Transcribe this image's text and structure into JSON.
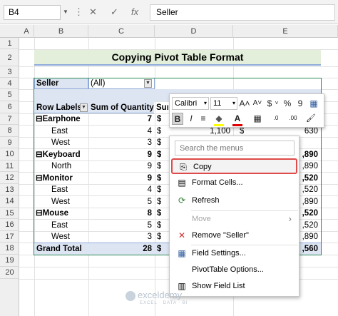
{
  "formula_bar": {
    "name_box": "B4",
    "more": "⋮",
    "cancel": "✕",
    "enter": "✓",
    "fx": "fx",
    "content": "Seller"
  },
  "columns": [
    "A",
    "B",
    "C",
    "D",
    "E"
  ],
  "rows": [
    "1",
    "2",
    "3",
    "4",
    "5",
    "6",
    "7",
    "8",
    "9",
    "10",
    "11",
    "12",
    "13",
    "14",
    "15",
    "16",
    "17",
    "18",
    "19",
    "20"
  ],
  "title": "Copying Pivot Table Format",
  "pivot": {
    "filter_label": "Seller",
    "filter_value": "(All)",
    "header_row_labels": "Row Labels",
    "header_sum_quantity": "Sum of Quantity",
    "header_sum_partial": "Sum",
    "groups": [
      {
        "name": "Earphone",
        "qty": "7",
        "currency": "$",
        "value": "",
        "children": [
          {
            "name": "East",
            "qty": "4",
            "currency": "$",
            "value": "1,100",
            "currency2": "$",
            "value2": "630"
          },
          {
            "name": "West",
            "qty": "3",
            "currency": "$",
            "value": "",
            "value2": ""
          }
        ]
      },
      {
        "name": "Keyboard",
        "qty": "9",
        "currency": "$",
        "value": "",
        "children": [
          {
            "name": "North",
            "qty": "9",
            "currency": "$",
            "value": ""
          }
        ]
      },
      {
        "name": "Monitor",
        "qty": "9",
        "currency": "$",
        "value": "",
        "children": [
          {
            "name": "East",
            "qty": "4",
            "currency": "$",
            "value": ""
          },
          {
            "name": "West",
            "qty": "5",
            "currency": "$",
            "value": ""
          }
        ]
      },
      {
        "name": "Mouse",
        "qty": "8",
        "currency": "$",
        "value": "",
        "children": [
          {
            "name": "East",
            "qty": "5",
            "currency": "$",
            "value": ""
          },
          {
            "name": "West",
            "qty": "3",
            "currency": "$",
            "value": ""
          }
        ]
      }
    ],
    "grand_total_label": "Grand Total",
    "grand_total_qty": "28",
    "grand_total_currency": "$",
    "right_column_values": [
      "630",
      ",890",
      ",890",
      ",520",
      ",520",
      ",890",
      ",520",
      ",520",
      ",890",
      ",560"
    ]
  },
  "mini_toolbar": {
    "font": "Calibri",
    "size": "11",
    "grow_font": "A˄",
    "shrink_font": "A˅",
    "currency": "$",
    "format_arrow": "˅",
    "percent": "%",
    "comma": "9",
    "bold": "B",
    "italic": "I",
    "align": "≡",
    "highlight": "◆",
    "font_color": "A",
    "borders": "▦",
    "dec_increase": ".0",
    "dec_decrease": ".00",
    "painter": "🖌"
  },
  "context_menu": {
    "search_placeholder": "Search the menus",
    "items": [
      {
        "label": "Copy",
        "icon": "⎘"
      },
      {
        "label": "Format Cells...",
        "icon": "▤"
      },
      {
        "label": "Refresh",
        "icon": "⟳"
      },
      {
        "label": "Move",
        "arrow": "›"
      },
      {
        "label": "Remove \"Seller\"",
        "icon": "✕"
      },
      {
        "label": "Field Settings...",
        "icon": "▦"
      },
      {
        "label": "PivotTable Options...",
        "icon": ""
      },
      {
        "label": "Show Field List",
        "icon": "▥"
      }
    ]
  },
  "watermark": {
    "name": "exceldemy",
    "sub": "EXCEL · DATA · BI"
  },
  "colors": {
    "pivot_band": "#dde5f2",
    "title_band": "#e3efda",
    "copy_border": "#e04a4a"
  }
}
